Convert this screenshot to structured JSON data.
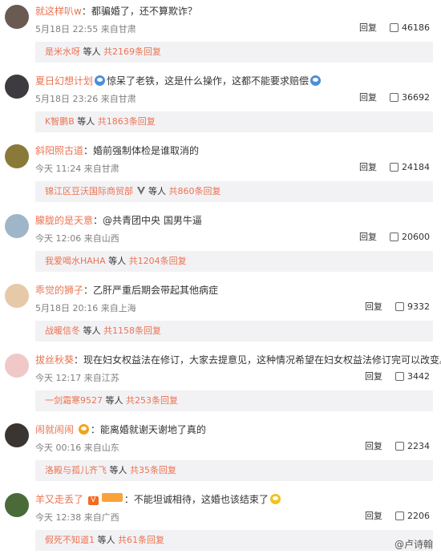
{
  "comments": [
    {
      "user": "就这样叭w",
      "text": "：都骗婚了，还不算欺诈？",
      "date": "5月18日 22:55",
      "source": "来自甘肃",
      "reply": "回复",
      "likes": "46186",
      "sub_user": "是米水呀",
      "sub_etc": "等人",
      "sub_count": "共2169条回复",
      "avatar_color": "#6b5a52"
    },
    {
      "user": "夏日幻想计划",
      "text": "惊呆了老铁，这是什么操作，这都不能要求赔偿",
      "date": "5月18日 23:26",
      "source": "来自甘肃",
      "reply": "回复",
      "likes": "36692",
      "sub_user": "K智鹏B",
      "sub_etc": "等人",
      "sub_count": "共1863条回复",
      "avatar_color": "#3d3a40"
    },
    {
      "user": "斜阳照古道",
      "text": "：婚前强制体检是谁取消的",
      "date": "今天 11:24",
      "source": "来自甘肃",
      "reply": "回复",
      "likes": "24184",
      "sub_user": "锦江区豆沃国际商贸部",
      "sub_etc": "等人",
      "sub_count": "共860条回复",
      "avatar_color": "#8a7a3a"
    },
    {
      "user": "朦胧的是天意",
      "text": "：@共青团中央 国男牛逼",
      "date": "今天 12:06",
      "source": "来自山西",
      "reply": "回复",
      "likes": "20600",
      "sub_user": "我爱喝水HAHA",
      "sub_etc": "等人",
      "sub_count": "共1204条回复",
      "avatar_color": "#9fb6c8"
    },
    {
      "user": "乖觉的狮子",
      "text": "：乙肝严重后期会带起其他病症",
      "date": "5月18日 20:16",
      "source": "来自上海",
      "reply": "回复",
      "likes": "9332",
      "sub_user": "战暖信冬",
      "sub_etc": "等人",
      "sub_count": "共1158条回复",
      "avatar_color": "#e6c9a8"
    },
    {
      "user": "拔丝秋葵",
      "text": "：现在妇女权益法在修订，大家去提意见，这种情况希望在妇女权益法修订完可以改变。",
      "date": "今天 12:17",
      "source": "来自江苏",
      "reply": "回复",
      "likes": "3442",
      "sub_user": "一剑霜寒9527",
      "sub_etc": "等人",
      "sub_count": "共253条回复",
      "avatar_color": "#f0c8c8"
    },
    {
      "user": "闹就闹闹",
      "text": "：能离婚就谢天谢地了真的",
      "date": "今天 00:16",
      "source": "来自山东",
      "reply": "回复",
      "likes": "2234",
      "sub_user": "洛殿与孤儿齐飞",
      "sub_etc": "等人",
      "sub_count": "共35条回复",
      "avatar_color": "#3a3530"
    },
    {
      "user": "羊又走丢了",
      "text": "：不能坦诚相待，这婚也该结束了",
      "date": "今天 12:38",
      "source": "来自广西",
      "reply": "回复",
      "likes": "2206",
      "sub_user": "假死不知道1",
      "sub_etc": "等人",
      "sub_count": "共61条回复",
      "avatar_color": "#4a6a3a"
    }
  ],
  "watermark": "@卢诗翰"
}
